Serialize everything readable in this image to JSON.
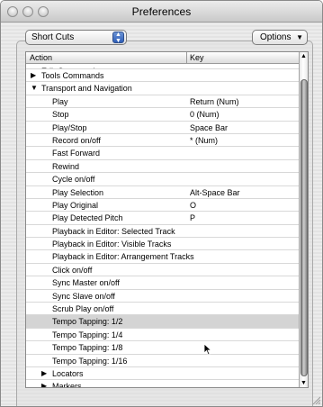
{
  "window": {
    "title": "Preferences"
  },
  "toolbar": {
    "category_popup": {
      "selected": "Short Cuts"
    },
    "options_button": {
      "label": "Options"
    }
  },
  "table": {
    "columns": {
      "action": "Action",
      "key": "Key"
    },
    "rows": [
      {
        "level": 0,
        "expander": "collapsed",
        "action": "Edit Commands",
        "key": "",
        "partial": true
      },
      {
        "level": 0,
        "expander": "collapsed",
        "action": "Tools Commands",
        "key": ""
      },
      {
        "level": 0,
        "expander": "expanded",
        "action": "Transport and Navigation",
        "key": ""
      },
      {
        "level": 1,
        "action": "Play",
        "key": "Return (Num)"
      },
      {
        "level": 1,
        "action": "Stop",
        "key": "0 (Num)"
      },
      {
        "level": 1,
        "action": "Play/Stop",
        "key": "Space Bar"
      },
      {
        "level": 1,
        "action": "Record on/off",
        "key": "* (Num)"
      },
      {
        "level": 1,
        "action": "Fast Forward",
        "key": ""
      },
      {
        "level": 1,
        "action": "Rewind",
        "key": ""
      },
      {
        "level": 1,
        "action": "Cycle on/off",
        "key": ""
      },
      {
        "level": 1,
        "action": "Play Selection",
        "key": "Alt-Space Bar"
      },
      {
        "level": 1,
        "action": "Play Original",
        "key": "O"
      },
      {
        "level": 1,
        "action": "Play Detected Pitch",
        "key": "P"
      },
      {
        "level": 1,
        "action": "Playback in Editor: Selected Track",
        "key": ""
      },
      {
        "level": 1,
        "action": "Playback in Editor: Visible Tracks",
        "key": ""
      },
      {
        "level": 1,
        "action": "Playback in Editor: Arrangement Tracks",
        "key": ""
      },
      {
        "level": 1,
        "action": "Click on/off",
        "key": ""
      },
      {
        "level": 1,
        "action": "Sync Master on/off",
        "key": ""
      },
      {
        "level": 1,
        "action": "Sync Slave on/off",
        "key": ""
      },
      {
        "level": 1,
        "action": "Scrub Play on/off",
        "key": ""
      },
      {
        "level": 1,
        "action": "Tempo Tapping: 1/2",
        "key": "",
        "selected": true
      },
      {
        "level": 1,
        "action": "Tempo Tapping: 1/4",
        "key": ""
      },
      {
        "level": 1,
        "action": "Tempo Tapping: 1/8",
        "key": ""
      },
      {
        "level": 1,
        "action": "Tempo Tapping: 1/16",
        "key": ""
      },
      {
        "level": 1,
        "expander": "collapsed",
        "action": "Locators",
        "key": ""
      },
      {
        "level": 1,
        "expander": "collapsed",
        "action": "Markers",
        "key": ""
      }
    ]
  },
  "icons": {
    "collapsed": "triangle-right-icon",
    "expanded": "triangle-down-icon",
    "window_controls": [
      "close-icon",
      "minimize-icon",
      "zoom-icon"
    ]
  },
  "colors": {
    "selection": "#d4d4d4",
    "popup_arrows": "#3a6cc4"
  }
}
